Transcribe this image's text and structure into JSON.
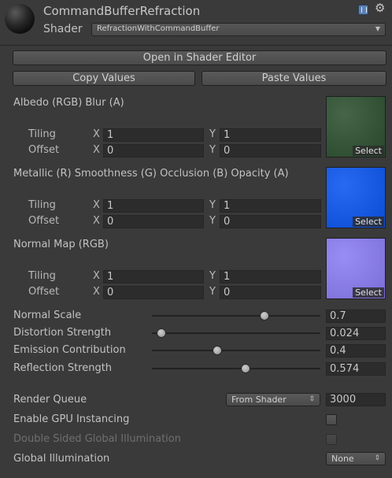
{
  "header": {
    "title": "CommandBufferRefraction",
    "shader_label": "Shader",
    "shader_value": "RefractionWithCommandBuffer",
    "help_icon": "book-icon",
    "settings_icon": "gear-icon"
  },
  "buttons": {
    "open": "Open in Shader Editor",
    "copy": "Copy Values",
    "paste": "Paste Values"
  },
  "texture_props": [
    {
      "label": "Albedo (RGB) Blur (A)",
      "tiling_label": "Tiling",
      "offset_label": "Offset",
      "tiling_x": "1",
      "tiling_y": "1",
      "offset_x": "0",
      "offset_y": "0",
      "x_label": "X",
      "y_label": "Y",
      "select": "Select",
      "color": "#2c5030"
    },
    {
      "label": "Metallic (R) Smoothness (G) Occlusion (B) Opacity (A)",
      "tiling_label": "Tiling",
      "offset_label": "Offset",
      "tiling_x": "1",
      "tiling_y": "1",
      "offset_x": "0",
      "offset_y": "0",
      "x_label": "X",
      "y_label": "Y",
      "select": "Select",
      "color": "#0a55f0"
    },
    {
      "label": "Normal Map (RGB)",
      "tiling_label": "Tiling",
      "offset_label": "Offset",
      "tiling_x": "1",
      "tiling_y": "1",
      "offset_x": "0",
      "offset_y": "0",
      "x_label": "X",
      "y_label": "Y",
      "select": "Select",
      "color": "#8a7cf4"
    }
  ],
  "sliders": [
    {
      "label": "Normal Scale",
      "value": "0.7",
      "fraction": 0.68
    },
    {
      "label": "Distortion Strength",
      "value": "0.024",
      "fraction": 0.03
    },
    {
      "label": "Emission Contribution",
      "value": "0.4",
      "fraction": 0.38
    },
    {
      "label": "Reflection Strength",
      "value": "0.574",
      "fraction": 0.56
    }
  ],
  "render_queue": {
    "label": "Render Queue",
    "mode": "From Shader",
    "value": "3000"
  },
  "gpu_instancing": {
    "label": "Enable GPU Instancing",
    "checked": false
  },
  "double_sided_gi": {
    "label": "Double Sided Global Illumination",
    "checked": false
  },
  "global_illumination": {
    "label": "Global Illumination",
    "value": "None"
  }
}
